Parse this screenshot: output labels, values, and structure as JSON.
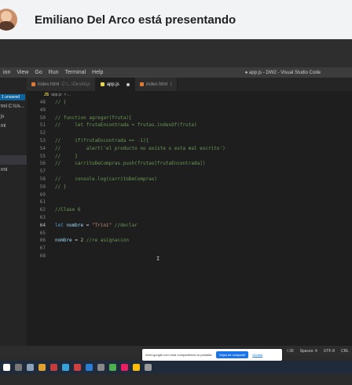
{
  "banner": {
    "title": "Emiliano Del Arco está presentando"
  },
  "menubar": {
    "items": [
      "ion",
      "View",
      "Go",
      "Run",
      "Terminal",
      "Help"
    ],
    "window_title": "● app.js - DW2 - Visual Studio Code"
  },
  "sidebar": {
    "badge": "1 unsaved",
    "rows": [
      "tml  C:\\Us...",
      "js",
      "ml",
      "rml"
    ]
  },
  "tabs": [
    {
      "label": "index.html",
      "sub": "C:\\...\\Desktop"
    },
    {
      "label": "app.js"
    },
    {
      "label": "index.html",
      "sub": "1"
    }
  ],
  "breadcrumb": {
    "file": "app.js",
    "rest": "> ..."
  },
  "code_lines": [
    {
      "n": "48",
      "t": "// }"
    },
    {
      "n": "49",
      "t": ""
    },
    {
      "n": "50",
      "t": "// function agregar(fruta){"
    },
    {
      "n": "51",
      "t": "//     let frutaEncontrada = frutas.indexOf(fruta)"
    },
    {
      "n": "52",
      "t": ""
    },
    {
      "n": "53",
      "t": "//     if(frutaEncontrada == -1){"
    },
    {
      "n": "54",
      "t": "//         alert('el producto no existe o esta mal escrito')"
    },
    {
      "n": "55",
      "t": "//     }"
    },
    {
      "n": "56",
      "t": "//     carritoDeCompras.push(frutas[frutaEncontrada])"
    },
    {
      "n": "57",
      "t": ""
    },
    {
      "n": "58",
      "t": "//     console.log(carritoDeCompras)"
    },
    {
      "n": "59",
      "t": "// }"
    },
    {
      "n": "60",
      "t": ""
    },
    {
      "n": "61",
      "t": ""
    },
    {
      "n": "62",
      "t": "//Clase 6"
    },
    {
      "n": "63",
      "t": ""
    },
    {
      "n": "64",
      "t": ""
    },
    {
      "n": "65",
      "t": ""
    },
    {
      "n": "66",
      "t": ""
    },
    {
      "n": "67",
      "t": ""
    },
    {
      "n": "68",
      "t": ""
    }
  ],
  "code_64": {
    "kw": "let",
    "var": "nombre",
    "op": " = ",
    "str": "\"Trini\"",
    "cm": " //declar"
  },
  "code_66": {
    "var": "nombre",
    "op": " = ",
    "num": "2",
    "cm": " //re asignacion"
  },
  "status": {
    "ln": "l 30",
    "spaces": "Spaces: 4",
    "enc": "UTF-8",
    "eol": "CRL"
  },
  "share": {
    "text": "meet.google.com está compartiendo tu pantalla.",
    "stop": "Dejar de compartir",
    "hide": "Ocultar"
  },
  "colors": {
    "accent": "#1a73e8",
    "editor_bg": "#1e1e1e",
    "comment": "#6a9955"
  }
}
